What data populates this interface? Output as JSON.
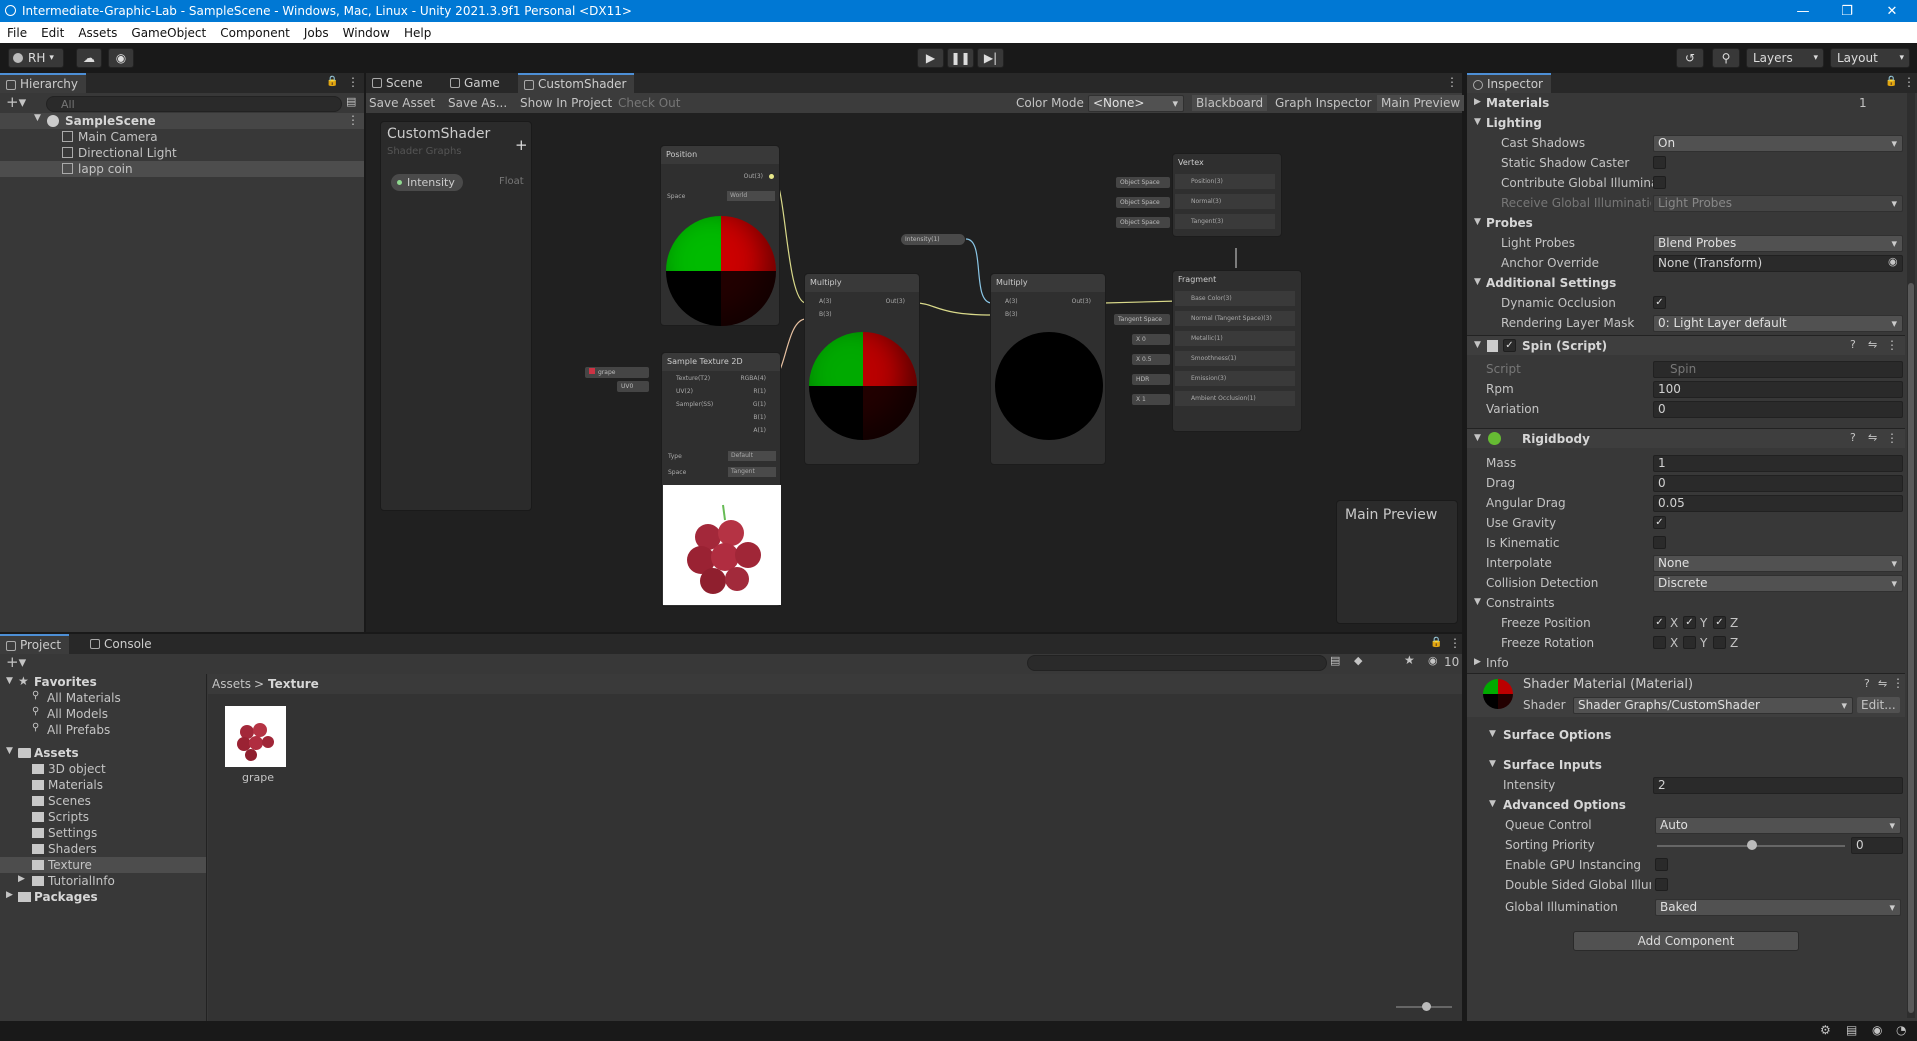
{
  "window": {
    "title": "Intermediate-Graphic-Lab - SampleScene - Windows, Mac, Linux - Unity 2021.3.9f1 Personal <DX11>"
  },
  "menu": [
    "File",
    "Edit",
    "Assets",
    "GameObject",
    "Component",
    "Jobs",
    "Window",
    "Help"
  ],
  "toolbar": {
    "account": "RH",
    "layers": "Layers",
    "layout": "Layout"
  },
  "hierarchy": {
    "tab": "Hierarchy",
    "search_placeholder": "All",
    "scene": "SampleScene",
    "items": [
      "Main Camera",
      "Directional Light",
      "lapp coin"
    ]
  },
  "center_tabs": [
    "Scene",
    "Game",
    "CustomShader"
  ],
  "graph_toolbar": {
    "save_asset": "Save Asset",
    "save_as": "Save As...",
    "show_in_project": "Show In Project",
    "check_out": "Check Out",
    "color_mode_label": "Color Mode",
    "color_mode_value": "<None>",
    "blackboard": "Blackboard",
    "graph_inspector": "Graph Inspector",
    "main_preview": "Main Preview"
  },
  "blackboard": {
    "title": "CustomShader",
    "subtitle": "Shader Graphs",
    "property": "Intensity",
    "property_type": "Float"
  },
  "graph": {
    "position_node": {
      "title": "Position",
      "out": "Out(3)",
      "space_label": "Space",
      "space_value": "World"
    },
    "sample_node": {
      "title": "Sample Texture 2D",
      "inputs": [
        "Texture(T2)",
        "UV(2)",
        "Sampler(SS)"
      ],
      "outputs": [
        "RGBA(4)",
        "R(1)",
        "G(1)",
        "B(1)",
        "A(1)"
      ],
      "type_label": "Type",
      "type_value": "Default",
      "space_label": "Space",
      "space_value": "Tangent",
      "tex_chip": "grape",
      "uv_chip": "UV0"
    },
    "multiply1": {
      "title": "Multiply",
      "inputs": [
        "A(3)",
        "B(3)"
      ],
      "out": "Out(3)"
    },
    "multiply2": {
      "title": "Multiply",
      "inputs": [
        "A(3)",
        "B(3)"
      ],
      "out": "Out(3)"
    },
    "intensity_chip": "Intensity(1)",
    "vertex": {
      "title": "Vertex",
      "slots": [
        "Position(3)",
        "Normal(3)",
        "Tangent(3)"
      ],
      "chips": [
        "Object Space",
        "Object Space",
        "Object Space"
      ]
    },
    "fragment": {
      "title": "Fragment",
      "slots": [
        "Base Color(3)",
        "Normal (Tangent Space)(3)",
        "Metallic(1)",
        "Smoothness(1)",
        "Emission(3)",
        "Ambient Occlusion(1)"
      ],
      "chips": [
        "",
        "Tangent Space",
        "X  0",
        "X  0.5",
        "HDR",
        "X  1"
      ]
    },
    "main_preview_title": "Main Preview"
  },
  "project": {
    "tabs": [
      "Project",
      "Console"
    ],
    "favorites_label": "Favorites",
    "favorites": [
      "All Materials",
      "All Models",
      "All Prefabs"
    ],
    "assets_label": "Assets",
    "folders": [
      "3D object",
      "Materials",
      "Scenes",
      "Scripts",
      "Settings",
      "Shaders",
      "Texture",
      "TutorialInfo"
    ],
    "packages_label": "Packages",
    "breadcrumb": [
      "Assets",
      "Texture"
    ],
    "asset_name": "grape",
    "hidden_count": "10"
  },
  "inspector": {
    "tab": "Inspector",
    "materials_label": "Materials",
    "materials_count": "1",
    "lighting": "Lighting",
    "cast_shadows_label": "Cast Shadows",
    "cast_shadows": "On",
    "static_shadow_label": "Static Shadow Caster",
    "contribute_gi_label": "Contribute Global Illuminat",
    "receive_gi_label": "Receive Global Illumination",
    "receive_gi": "Light Probes",
    "probes": "Probes",
    "light_probes_label": "Light Probes",
    "light_probes": "Blend Probes",
    "anchor_label": "Anchor Override",
    "anchor": "None (Transform)",
    "additional": "Additional Settings",
    "dynamic_occlusion_label": "Dynamic Occlusion",
    "rendering_layer_label": "Rendering Layer Mask",
    "rendering_layer": "0: Light Layer default",
    "spin_title": "Spin (Script)",
    "script_label": "Script",
    "script_value": "Spin",
    "rpm_label": "Rpm",
    "rpm": "100",
    "variation_label": "Variation",
    "variation": "0",
    "rigidbody_title": "Rigidbody",
    "mass_label": "Mass",
    "mass": "1",
    "drag_label": "Drag",
    "drag": "0",
    "angular_drag_label": "Angular Drag",
    "angular_drag": "0.05",
    "use_gravity_label": "Use Gravity",
    "is_kinematic_label": "Is Kinematic",
    "interpolate_label": "Interpolate",
    "interpolate": "None",
    "collision_label": "Collision Detection",
    "collision": "Discrete",
    "constraints": "Constraints",
    "freeze_pos_label": "Freeze Position",
    "freeze_rot_label": "Freeze Rotation",
    "axes": [
      "X",
      "Y",
      "Z"
    ],
    "info": "Info",
    "material_title": "Shader Material (Material)",
    "shader_label": "Shader",
    "shader": "Shader Graphs/CustomShader",
    "edit": "Edit...",
    "surface_options": "Surface Options",
    "surface_inputs": "Surface Inputs",
    "intensity_label": "Intensity",
    "intensity": "2",
    "advanced_options": "Advanced Options",
    "queue_label": "Queue Control",
    "queue": "Auto",
    "sorting_label": "Sorting Priority",
    "sorting": "0",
    "sorting_slider": 0.5,
    "gpu_label": "Enable GPU Instancing",
    "dsgi_label": "Double Sided Global Illumi",
    "gi_label": "Global Illumination",
    "gi": "Baked",
    "add_component": "Add Component"
  }
}
